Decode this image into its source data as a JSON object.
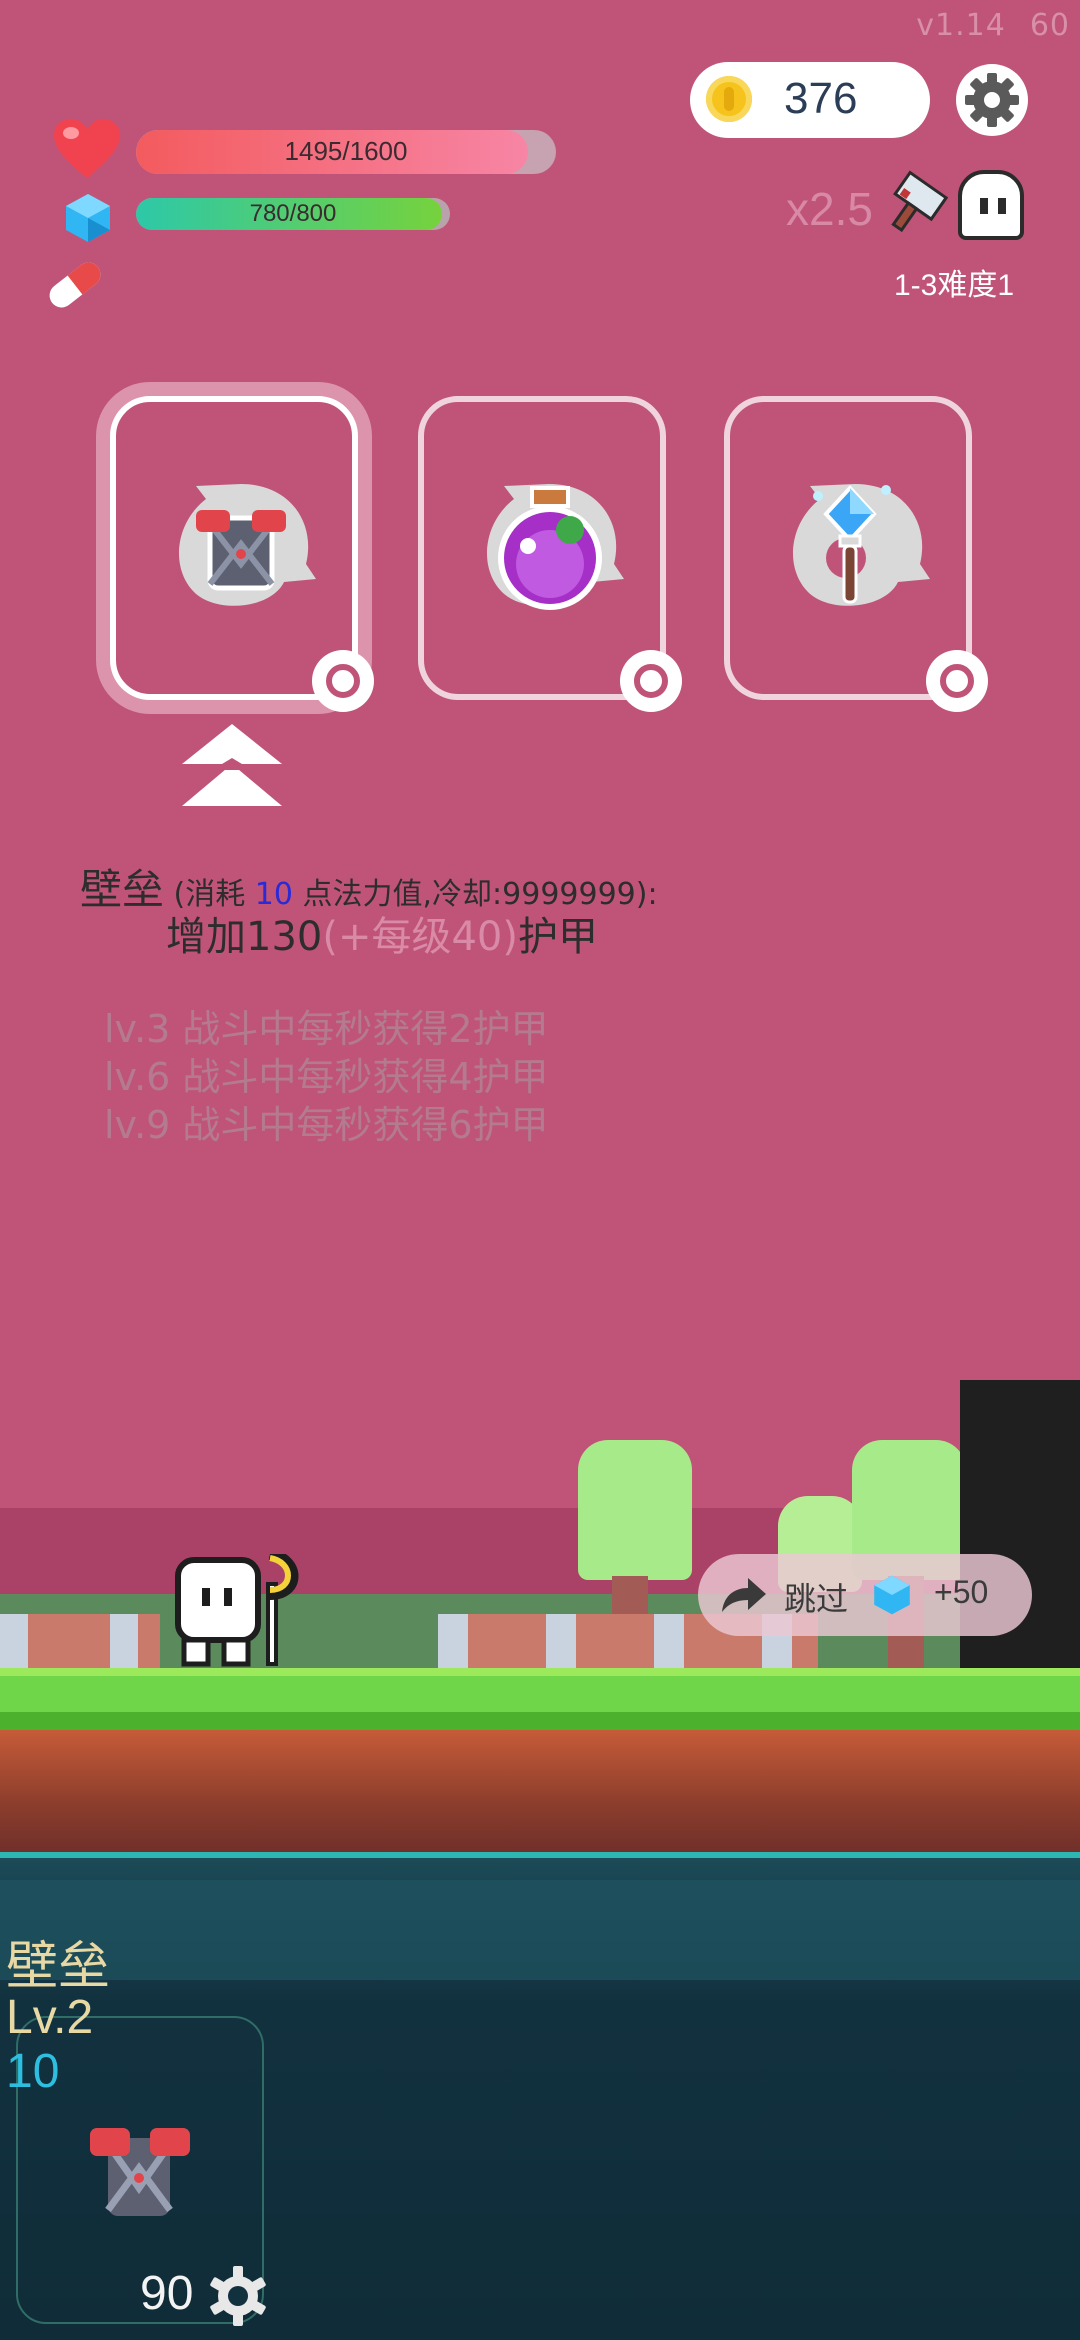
{
  "version": "v1.14",
  "fps": "60",
  "coins": "376",
  "hp": {
    "text": "1495/1600",
    "fraction": 0.934
  },
  "mp": {
    "text": "780/800",
    "fraction": 0.975
  },
  "speed": "x2.5",
  "stage": "1-3难度1",
  "cards": [
    {
      "name": "armor-card",
      "selected": true
    },
    {
      "name": "potion-card",
      "selected": false
    },
    {
      "name": "wand-card",
      "selected": false
    }
  ],
  "description": {
    "title": "壁垒",
    "cost_prefix": " (消耗 ",
    "cost_value": "10",
    "cost_suffix": " 点法力值,冷却:9999999):",
    "effect_main": "增加130",
    "effect_faint": "(+每级40)",
    "effect_tail": "护甲",
    "levels": [
      "lv.3 战斗中每秒获得2护甲",
      "lv.6 战斗中每秒获得4护甲",
      "lv.9 战斗中每秒获得6护甲"
    ]
  },
  "skip": {
    "label": "跳过",
    "reward": "+50"
  },
  "skill": {
    "name": "壁垒",
    "level": "Lv.2",
    "cost": "10",
    "count": "90"
  },
  "colors": {
    "background": "#c05478",
    "grass": "#6fd64a",
    "deep": "#0f2c38"
  }
}
